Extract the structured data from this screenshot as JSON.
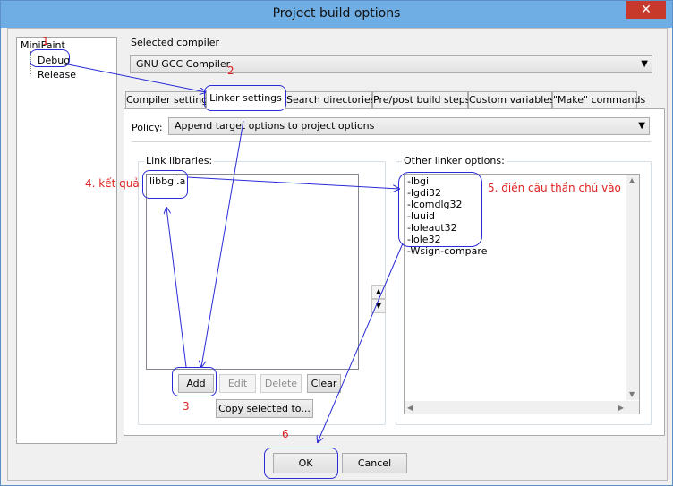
{
  "window": {
    "title": "Project build options",
    "close_glyph": "✕"
  },
  "tree": {
    "root": "MiniPaint",
    "items": [
      "Debug",
      "Release"
    ]
  },
  "compiler": {
    "label": "Selected compiler",
    "value": "GNU GCC Compiler"
  },
  "tabs": [
    "Compiler settings",
    "Linker settings",
    "Search directories",
    "Pre/post build steps",
    "Custom variables",
    "\"Make\" commands"
  ],
  "policy": {
    "label": "Policy:",
    "value": "Append target options to project options"
  },
  "link_libraries": {
    "title": "Link libraries:",
    "items": [
      "libbgi.a"
    ]
  },
  "other_linker": {
    "title": "Other linker options:",
    "lines": [
      "-lbgi",
      "-lgdi32",
      "-lcomdlg32",
      "-luuid",
      "-loleaut32",
      "-lole32",
      "-Wsign-compare"
    ]
  },
  "buttons": {
    "add": "Add",
    "edit": "Edit",
    "delete": "Delete",
    "clear": "Clear",
    "copy": "Copy selected to...",
    "ok": "OK",
    "cancel": "Cancel"
  },
  "annotations": {
    "n1": "1",
    "n2": "2",
    "n3": "3",
    "n4": "4. kết quả",
    "n5": "5. điền câu thần chú vào",
    "n6": "6"
  },
  "colors": {
    "annotation_text": "#e02020",
    "annotation_lines": "#2a2ad6",
    "titlebar": "#6faee4"
  }
}
